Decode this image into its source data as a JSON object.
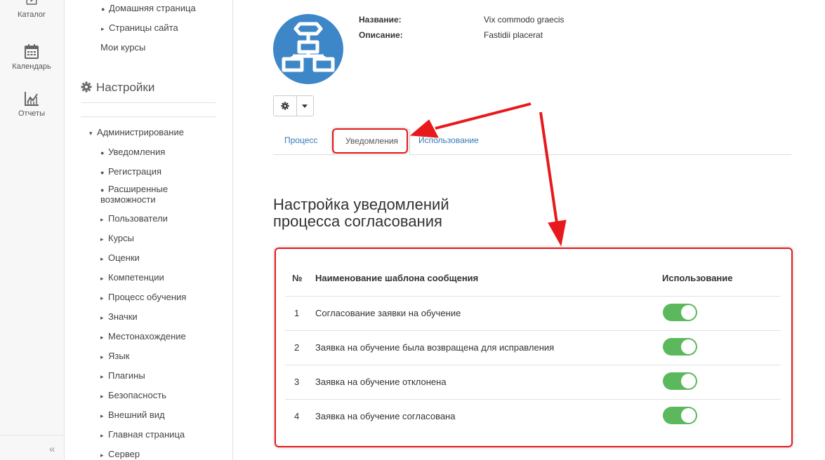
{
  "rail": {
    "catalog_label": "Каталог",
    "calendar_label": "Календарь",
    "reports_label": "Отчеты",
    "collapse_glyph": "«"
  },
  "nav": {
    "items_top": [
      {
        "marker": "●",
        "label": "Домашняя страница"
      },
      {
        "marker": "▸",
        "label": "Страницы сайта"
      },
      {
        "marker": "",
        "label": "Мои курсы"
      }
    ],
    "settings_heading": "Настройки",
    "admin_label": "Администрирование",
    "admin_marker": "▾",
    "admin_items": [
      {
        "marker": "●",
        "label": "Уведомления"
      },
      {
        "marker": "●",
        "label": "Регистрация"
      },
      {
        "marker": "●",
        "label": "Расширенные",
        "label2": "возможности"
      },
      {
        "marker": "▸",
        "label": "Пользователи"
      },
      {
        "marker": "▸",
        "label": "Курсы"
      },
      {
        "marker": "▸",
        "label": "Оценки"
      },
      {
        "marker": "▸",
        "label": "Компетенции"
      },
      {
        "marker": "▸",
        "label": "Процесс обучения"
      },
      {
        "marker": "▸",
        "label": "Значки"
      },
      {
        "marker": "▸",
        "label": "Местонахождение"
      },
      {
        "marker": "▸",
        "label": "Язык"
      },
      {
        "marker": "▸",
        "label": "Плагины"
      },
      {
        "marker": "▸",
        "label": "Безопасность"
      },
      {
        "marker": "▸",
        "label": "Внешний вид"
      },
      {
        "marker": "▸",
        "label": "Главная страница"
      },
      {
        "marker": "▸",
        "label": "Сервер"
      }
    ]
  },
  "info": {
    "name_label": "Название:",
    "name_value": "Vix commodo graecis",
    "description_label": "Описание:",
    "description_value": "Fastidii placerat"
  },
  "tabs": [
    {
      "label": "Процесс",
      "active": false
    },
    {
      "label": "Уведомления",
      "active": true
    },
    {
      "label": "Использование",
      "active": false
    }
  ],
  "heading": {
    "line1": "Настройка уведомлений",
    "line2": "процесса согласования"
  },
  "table": {
    "headers": {
      "num": "№",
      "name": "Наименование шаблона сообщения",
      "usage": "Использование"
    },
    "rows": [
      {
        "num": "1",
        "name": "Согласование заявки на обучение",
        "enabled": true
      },
      {
        "num": "2",
        "name": "Заявка на обучение была возвращена для исправления",
        "enabled": true
      },
      {
        "num": "3",
        "name": "Заявка на обучение отклонена",
        "enabled": true
      },
      {
        "num": "4",
        "name": "Заявка на обучение согласована",
        "enabled": true
      }
    ]
  },
  "colors": {
    "brand_blue": "#3d87c9",
    "toggle_on": "#5cb85c",
    "annotation_red": "#e8191c",
    "link_blue": "#337ab7"
  }
}
